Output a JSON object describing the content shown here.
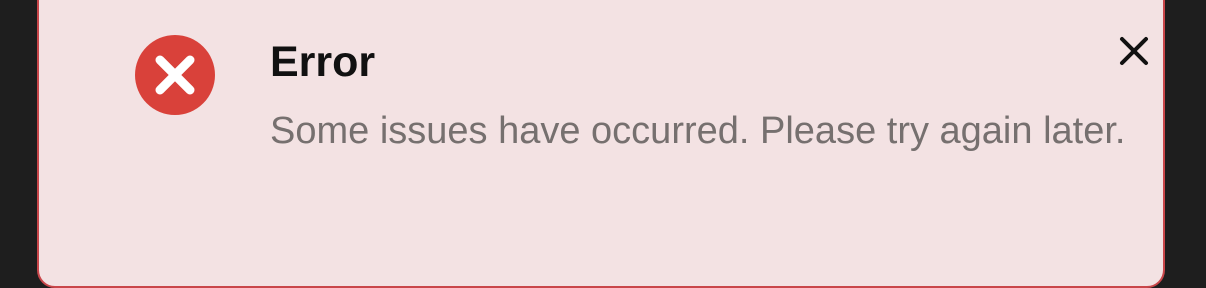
{
  "alert": {
    "title": "Error",
    "message": "Some issues have occurred. Please try again later.",
    "icon": "error-circle-icon",
    "close_icon": "close-icon",
    "colors": {
      "background": "#f3e2e3",
      "border": "#c9464a",
      "icon": "#d9413a",
      "title": "#111111",
      "message": "#76706f"
    }
  }
}
